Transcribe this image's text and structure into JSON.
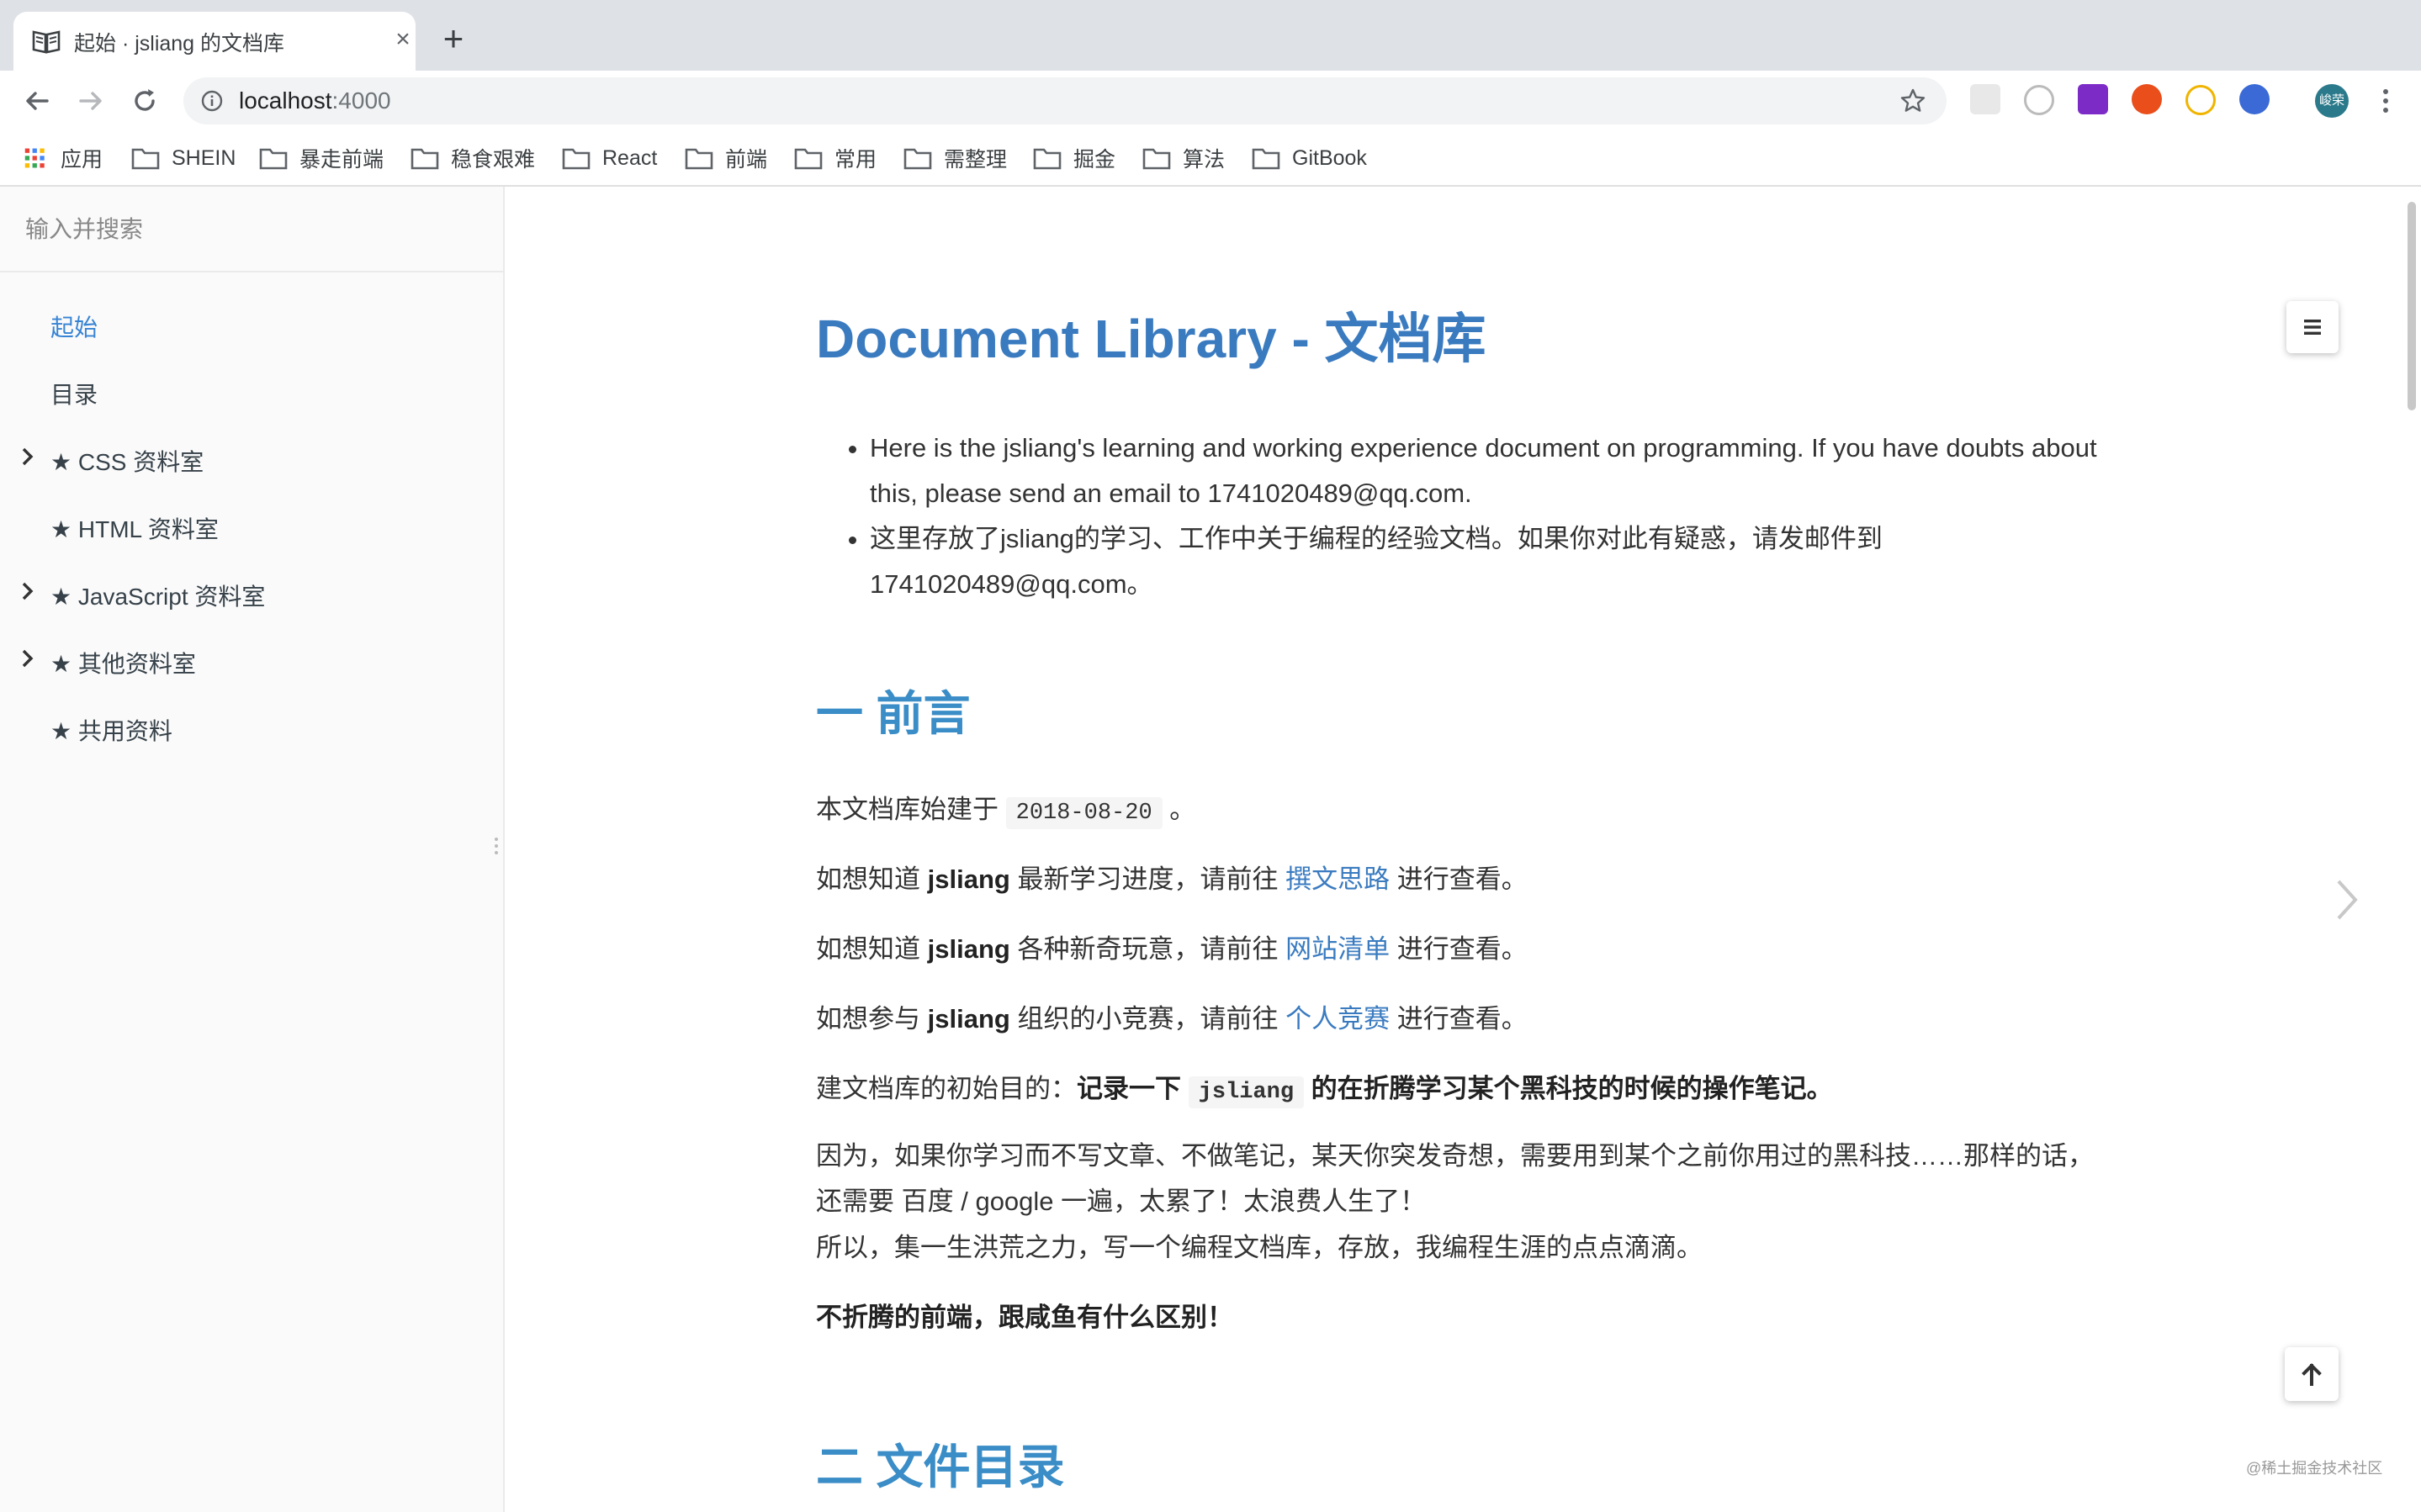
{
  "browser": {
    "tab_title": "起始 · jsliang 的文档库",
    "url_host": "localhost",
    "url_port": ":4000",
    "avatar_text": "峻荣",
    "bookmarks": [
      "应用",
      "SHEIN",
      "暴走前端",
      "稳食艰难",
      "React",
      "前端",
      "常用",
      "需整理",
      "掘金",
      "算法",
      "GitBook"
    ]
  },
  "sidebar": {
    "search_placeholder": "输入并搜索",
    "items": [
      {
        "label": "起始",
        "active": true,
        "expandable": false
      },
      {
        "label": "目录",
        "active": false,
        "expandable": false
      },
      {
        "label": "★ CSS 资料室",
        "active": false,
        "expandable": true
      },
      {
        "label": "★ HTML 资料室",
        "active": false,
        "expandable": false
      },
      {
        "label": "★ JavaScript 资料室",
        "active": false,
        "expandable": true
      },
      {
        "label": "★ 其他资料室",
        "active": false,
        "expandable": true
      },
      {
        "label": "★ 共用资料",
        "active": false,
        "expandable": false
      }
    ]
  },
  "content": {
    "title": "Document Library - 文档库",
    "intro": [
      "Here is the jsliang's learning and working experience document on programming. If you have doubts about this, please send an email to 1741020489@qq.com.",
      "这里存放了jsliang的学习、工作中关于编程的经验文档。如果你对此有疑惑，请发邮件到1741020489@qq.com。"
    ],
    "section1_title": "一 前言",
    "p_start_prefix": "本文档库始建于",
    "p_start_date": "2018-08-20",
    "p_start_suffix": "。",
    "p_progress": {
      "a": "如想知道",
      "b": "jsliang",
      "c": "最新学习进度，请前往",
      "link": "撰文思路",
      "d": "进行查看。"
    },
    "p_sites": {
      "a": "如想知道",
      "b": "jsliang",
      "c": "各种新奇玩意，请前往",
      "link": "网站清单",
      "d": "进行查看。"
    },
    "p_contest": {
      "a": "如想参与",
      "b": "jsliang",
      "c": "组织的小竞赛，请前往",
      "link": "个人竞赛",
      "d": "进行查看。"
    },
    "p_purpose": {
      "a": "建文档库的初始目的：",
      "b": "记录一下",
      "code": "jsliang",
      "c": "的在折腾学习某个黑科技的时候的操作笔记。"
    },
    "p_because": "因为，如果你学习而不写文章、不做笔记，某天你突发奇想，需要用到某个之前你用过的黑科技……那样的话，还需要 百度 / google 一遍，太累了！太浪费人生了！",
    "p_so": "所以，集一生洪荒之力，写一个编程文档库，存放，我编程生涯的点点滴滴。",
    "p_bold": "不折腾的前端，跟咸鱼有什么区别！",
    "section2_title": "二 文件目录",
    "watermark": "@稀土掘金技术社区"
  },
  "colors": {
    "accent": "#3a7bc0",
    "heading": "#3a8dc7",
    "active_nav": "#3884d4"
  }
}
